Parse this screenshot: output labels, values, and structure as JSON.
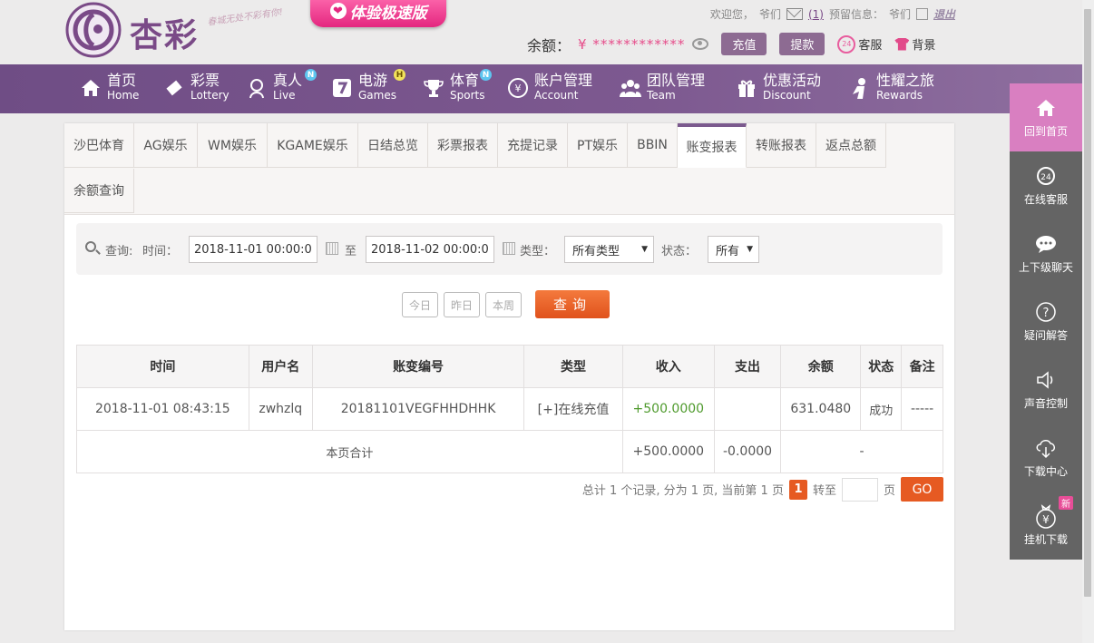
{
  "header": {
    "logo_text": "杏彩",
    "slogan": "春城无处不彩有你!",
    "promo_label": "体验极速版",
    "welcome": "欢迎您，",
    "username": "爷们",
    "mail_count": "(1)",
    "notice_label": "预留信息：",
    "notice_value": "爷们",
    "logout": "退出",
    "balance_label": "余额：",
    "balance_value": "¥ ************",
    "deposit_btn": "充值",
    "withdraw_btn": "提款",
    "service_label": "客服",
    "service_icon_text": "24",
    "background_label": "背景"
  },
  "nav": [
    {
      "zh": "首页",
      "en": "Home",
      "icon": "home-icon"
    },
    {
      "zh": "彩票",
      "en": "Lottery",
      "icon": "lottery-icon"
    },
    {
      "zh": "真人",
      "en": "Live",
      "icon": "live-icon",
      "badge": "N"
    },
    {
      "zh": "电游",
      "en": "Games",
      "icon": "games-icon",
      "badge": "H"
    },
    {
      "zh": "体育",
      "en": "Sports",
      "icon": "trophy-icon",
      "badge": "N"
    },
    {
      "zh": "账户管理",
      "en": "Account",
      "icon": "account-icon"
    },
    {
      "zh": "团队管理",
      "en": "Team",
      "icon": "team-icon"
    },
    {
      "zh": "优惠活动",
      "en": "Discount",
      "icon": "gift-icon"
    },
    {
      "zh": "性耀之旅",
      "en": "Rewards",
      "icon": "rewards-icon"
    }
  ],
  "tabs": [
    "沙巴体育",
    "AG娱乐",
    "WM娱乐",
    "KGAME娱乐",
    "日结总览",
    "彩票报表",
    "充提记录",
    "PT娱乐",
    "BBIN",
    "账变报表",
    "转账报表",
    "返点总额",
    "余额查询"
  ],
  "active_tab": "账变报表",
  "filter": {
    "query_label": "查询:",
    "time_label": "时间：",
    "start_time": "2018-11-01 00:00:00",
    "to_label": "至",
    "end_time": "2018-11-02 00:00:00",
    "type_label": "类型：",
    "type_value": "所有类型",
    "status_label": "状态：",
    "status_value": "所有"
  },
  "quick": {
    "today": "今日",
    "yesterday": "昨日",
    "week": "本周",
    "query": "查询"
  },
  "table": {
    "headers": [
      "时间",
      "用户名",
      "账变编号",
      "类型",
      "收入",
      "支出",
      "余额",
      "状态",
      "备注"
    ],
    "rows": [
      [
        "2018-11-01 08:43:15",
        "zwhzlq",
        "20181101VEGFHHDHHK",
        "[+]在线充值",
        "+500.0000",
        "",
        "631.0480",
        "成功",
        "-----"
      ]
    ],
    "total": {
      "label": "本页合计",
      "income": "+500.0000",
      "expense": "-0.0000",
      "balance": "-"
    }
  },
  "pager": {
    "summary": "总计 1 个记录, 分为 1 页, 当前第 1 页",
    "current": "1",
    "goto_label": "转至",
    "page_label": "页",
    "go": "GO"
  },
  "rail": [
    {
      "label": "回到首页",
      "icon": "home-icon"
    },
    {
      "label": "在线客服",
      "icon": "support-24-icon"
    },
    {
      "label": "上下级聊天",
      "icon": "chat-icon"
    },
    {
      "label": "疑问解答",
      "icon": "question-icon"
    },
    {
      "label": "声音控制",
      "icon": "speaker-icon"
    },
    {
      "label": "下载中心",
      "icon": "cloud-download-icon"
    },
    {
      "label": "挂机下载",
      "icon": "money-bag-icon",
      "badge": "新"
    }
  ]
}
